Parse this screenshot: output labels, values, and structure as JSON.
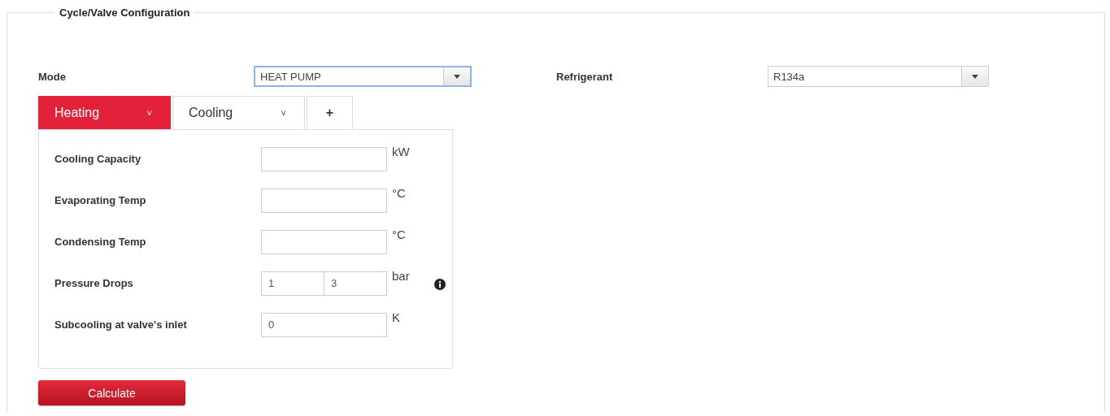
{
  "section": {
    "title": "Cycle/Valve Configuration"
  },
  "selects": [
    {
      "label": "Mode",
      "value": "HEAT PUMP",
      "focused": true
    },
    {
      "label": "Refrigerant",
      "value": "R134a",
      "focused": false
    }
  ],
  "tabs": [
    {
      "kind": "menu",
      "label": "Heating",
      "caret": "˅",
      "selected": true
    },
    {
      "kind": "menu",
      "label": "Cooling",
      "caret": "˅",
      "selected": false
    },
    {
      "kind": "add",
      "label": "+",
      "selected": false
    }
  ],
  "fields": [
    {
      "kind": "single",
      "label": "Cooling Capacity",
      "unit": "kW"
    },
    {
      "kind": "single",
      "label": "Evaporating Temp",
      "unit": "°C"
    },
    {
      "kind": "single",
      "label": "Condensing Temp",
      "unit": "°C"
    },
    {
      "kind": "pair",
      "label": "Pressure Drops",
      "values": [
        "1",
        "3"
      ],
      "unit": "bar",
      "info": true
    },
    {
      "kind": "single",
      "label": "Subcooling at valve's inlet",
      "value": "0",
      "unit": "K"
    }
  ],
  "calculate_button": "Calculate"
}
